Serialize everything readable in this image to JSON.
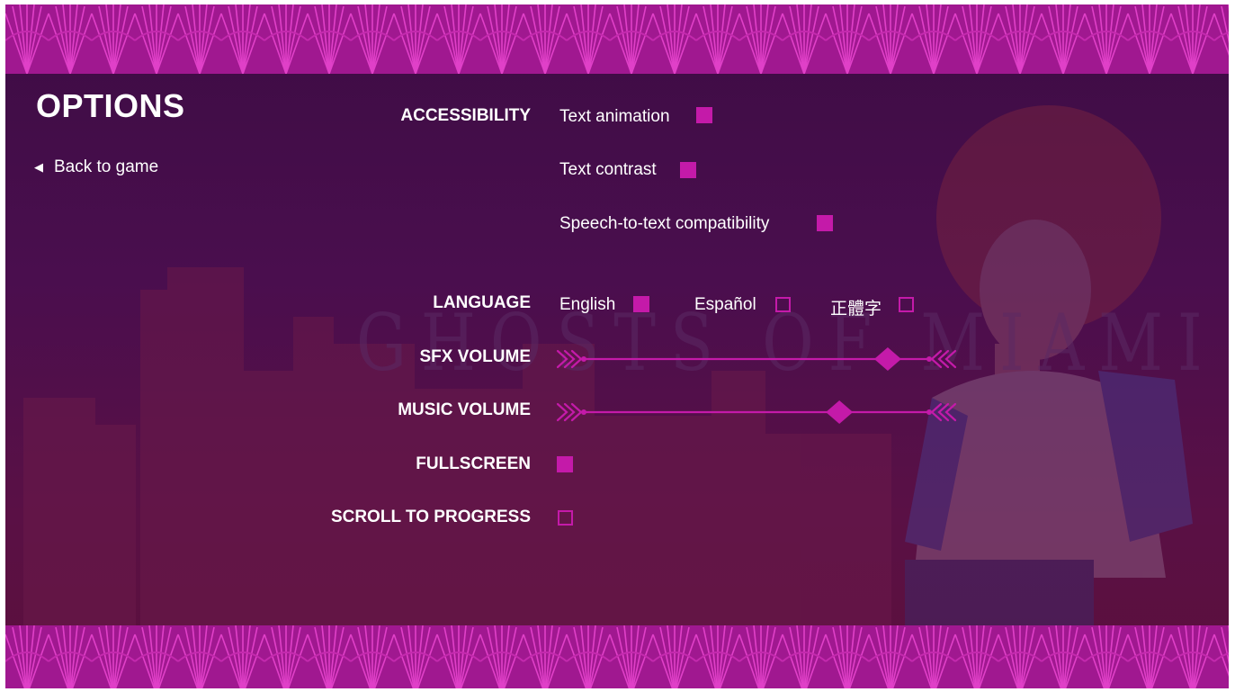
{
  "colors": {
    "accent": "#c41aa9",
    "band": "#a01890",
    "background": "#3d0c44"
  },
  "header": {
    "title": "OPTIONS"
  },
  "nav": {
    "back_label": "Back to game",
    "back_icon": "left-triangle-icon"
  },
  "watermark": "GHOSTS OF MIAMI",
  "accessibility": {
    "label": "ACCESSIBILITY",
    "options": [
      {
        "label": "Text animation",
        "checked": true
      },
      {
        "label": "Text contrast",
        "checked": true
      },
      {
        "label": "Speech-to-text compatibility",
        "checked": true
      }
    ]
  },
  "language": {
    "label": "LANGUAGE",
    "options": [
      {
        "label": "English",
        "checked": true
      },
      {
        "label": "Español",
        "checked": false
      },
      {
        "label": "正體字",
        "checked": false
      }
    ]
  },
  "sfx_volume": {
    "label": "SFX VOLUME",
    "value": 0.88
  },
  "music_volume": {
    "label": "MUSIC VOLUME",
    "value": 0.74
  },
  "fullscreen": {
    "label": "FULLSCREEN",
    "checked": true
  },
  "scroll_to_progress": {
    "label": "SCROLL TO PROGRESS",
    "checked": false
  }
}
